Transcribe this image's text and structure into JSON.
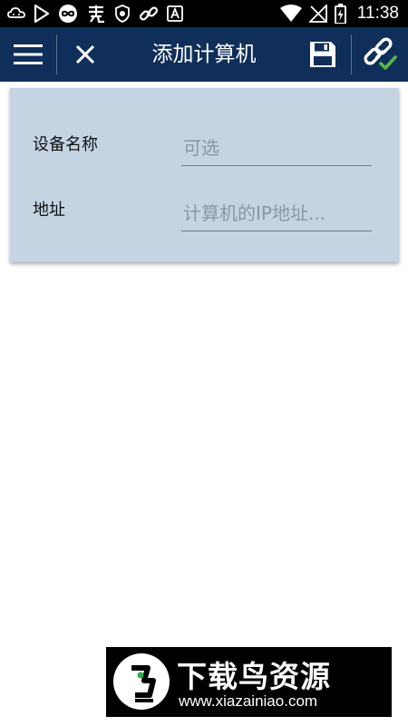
{
  "status_bar": {
    "time": "11:38",
    "left_icons": [
      "cloud-icon",
      "play-store-icon",
      "infinity-icon",
      "app-icon",
      "shield-icon",
      "link-icon",
      "text-icon"
    ],
    "right_icons": [
      "wifi-icon",
      "signal-off-icon",
      "battery-charging-icon"
    ]
  },
  "app_bar": {
    "title": "添加计算机",
    "icons": [
      "menu-icon",
      "close-icon",
      "save-icon",
      "link-check-icon"
    ],
    "background": "#0f2f5a"
  },
  "form": {
    "name_label": "设备名称",
    "name_placeholder": "可选",
    "name_value": "",
    "address_label": "地址",
    "address_placeholder": "计算机的IP地址...",
    "address_value": "",
    "card_background": "#c5d4e3"
  },
  "watermark": {
    "brand": "下载鸟资源",
    "url": "www.xiazainiao.com"
  }
}
